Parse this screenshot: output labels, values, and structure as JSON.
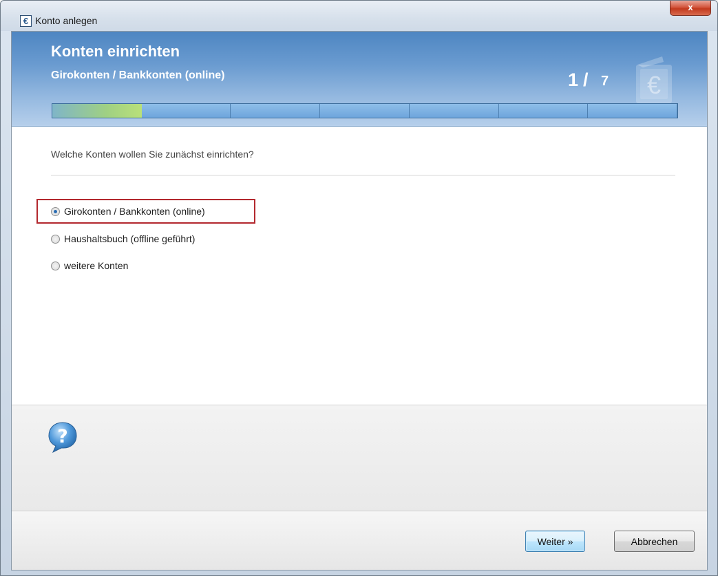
{
  "window": {
    "title": "Konto anlegen",
    "icon": "euro-icon",
    "close_label": "x"
  },
  "header": {
    "title": "Konten einrichten",
    "subtitle": "Girokonten / Bankkonten (online)",
    "step_current": "1",
    "step_separator": "/",
    "step_total": "7",
    "progress_fraction": 0.143,
    "progress_segments": 7
  },
  "main": {
    "question": "Welche Konten wollen Sie zunächst einrichten?",
    "options": [
      {
        "label": "Girokonten / Bankkonten (online)",
        "checked": true
      },
      {
        "label": "Haushaltsbuch (offline geführt)",
        "checked": false
      },
      {
        "label": "weitere Konten",
        "checked": false
      }
    ]
  },
  "help": {
    "icon": "help-question-icon"
  },
  "footer": {
    "next_label": "Weiter »",
    "cancel_label": "Abbrechen"
  },
  "colors": {
    "header_blue": "#6a9bd0",
    "highlight_red": "#b3282e",
    "progress_green": "#9fd083"
  }
}
